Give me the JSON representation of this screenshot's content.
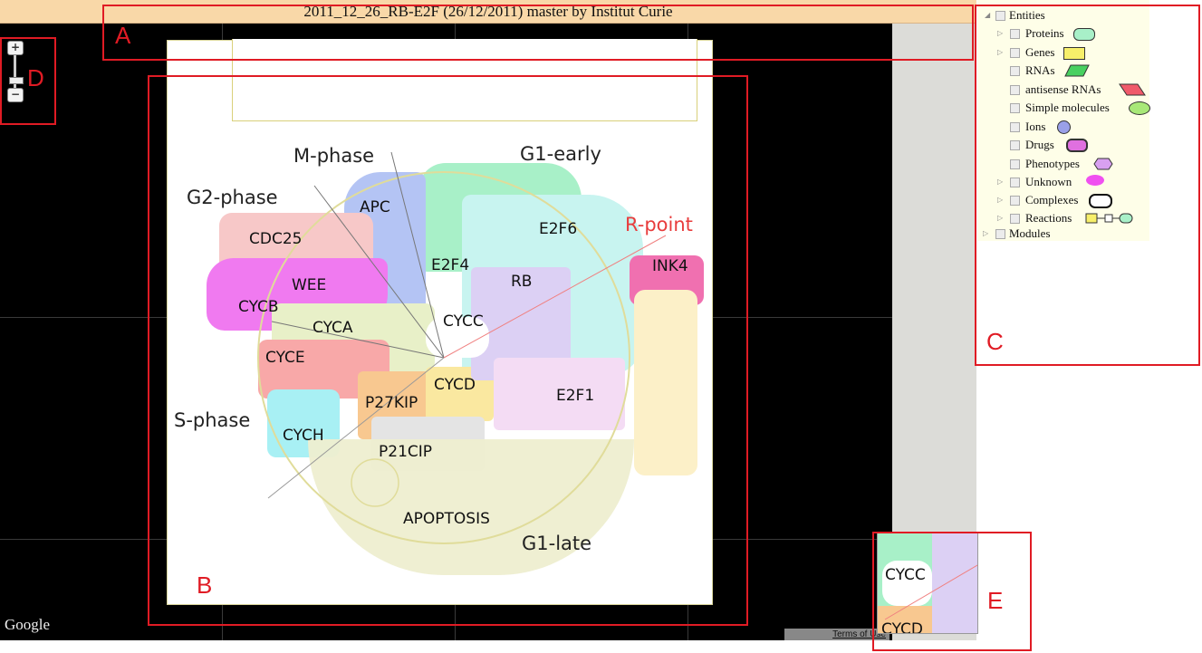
{
  "map": {
    "title": "2011_12_26_RB-E2F (26/12/2011) master by Institut Curie",
    "zoom": {
      "in_label": "+",
      "out_label": "−"
    },
    "attribution": "Google",
    "terms": "Terms of Use",
    "phases": [
      "M-phase",
      "G1-early",
      "G2-phase",
      "R-point",
      "S-phase",
      "G1-late"
    ],
    "modules": [
      "APC",
      "CDC25",
      "E2F6",
      "E2F4",
      "INK4",
      "WEE",
      "RB",
      "CYCB",
      "CYCA",
      "CYCC",
      "CYCE",
      "CYCD",
      "P27KIP",
      "E2F1",
      "CYCH",
      "P21CIP",
      "APOPTOSIS"
    ]
  },
  "overview": {
    "label_top": "CYCC",
    "label_bottom": "CYCD"
  },
  "tree": {
    "root": "Entities",
    "items": [
      {
        "label": "Proteins",
        "icon": "protein-icon",
        "color": "#a8f0c8",
        "expandable": true
      },
      {
        "label": "Genes",
        "icon": "gene-icon",
        "color": "#f7ef6a",
        "expandable": true
      },
      {
        "label": "RNAs",
        "icon": "rna-icon",
        "color": "#48d060",
        "expandable": false
      },
      {
        "label": "antisense RNAs",
        "icon": "antisense-rna-icon",
        "color": "#f05a6a",
        "expandable": false
      },
      {
        "label": "Simple molecules",
        "icon": "simple-molecule-icon",
        "color": "#a8e878",
        "expandable": false
      },
      {
        "label": "Ions",
        "icon": "ion-icon",
        "color": "#9aa0e8",
        "expandable": false
      },
      {
        "label": "Drugs",
        "icon": "drug-icon",
        "color": "#e070e0",
        "expandable": false
      },
      {
        "label": "Phenotypes",
        "icon": "phenotype-icon",
        "color": "#d8a0f0",
        "expandable": false
      },
      {
        "label": "Unknown",
        "icon": "unknown-icon",
        "color": "#f050f0",
        "expandable": true
      },
      {
        "label": "Complexes",
        "icon": "complex-icon",
        "color": "#ffffff",
        "expandable": true
      },
      {
        "label": "Reactions",
        "icon": "reaction-icon",
        "color": "#f7ef6a",
        "expandable": true
      }
    ],
    "modules_label": "Modules"
  },
  "annotations": [
    "A",
    "B",
    "C",
    "D",
    "E"
  ],
  "colors": {
    "annotation": "#e01b24",
    "title_bar": "#f9d8a8",
    "tree_bg": "#fefee8"
  }
}
